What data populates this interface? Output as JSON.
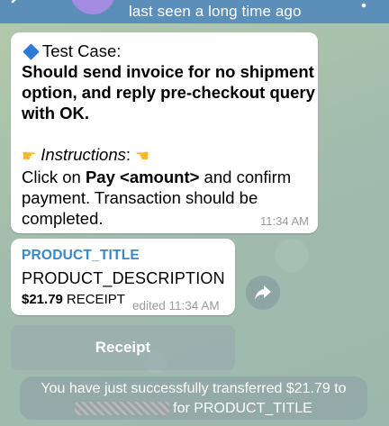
{
  "header": {
    "status": "last seen a long time ago"
  },
  "message": {
    "heading": "Test Case:",
    "title_lines": [
      "Should send invoice for no shipment",
      "option, and reply pre-checkout query",
      "with OK."
    ],
    "instructions_label": "Instructions",
    "instructions_colon": ":",
    "line_a_pre": "Click on ",
    "line_a_bold": "Pay <amount>",
    "line_a_post": " and confirm",
    "line_b": "payment. Transaction should be",
    "line_c": "completed.",
    "time": "11:34 AM"
  },
  "invoice": {
    "title": "PRODUCT_TITLE",
    "description": "PRODUCT_DESCRIPTION",
    "price": "$21.79",
    "receipt_label": "RECEIPT",
    "edited": "edited 11:34 AM"
  },
  "receipt_button": {
    "label": "Receipt"
  },
  "service": {
    "line1": "You have just successfully transferred $21.79 to",
    "line2": "for PRODUCT_TITLE"
  },
  "icons": {
    "diamond": "blue-diamond-icon",
    "hand": "pointing-hand-icon",
    "share": "share-arrow-icon"
  }
}
